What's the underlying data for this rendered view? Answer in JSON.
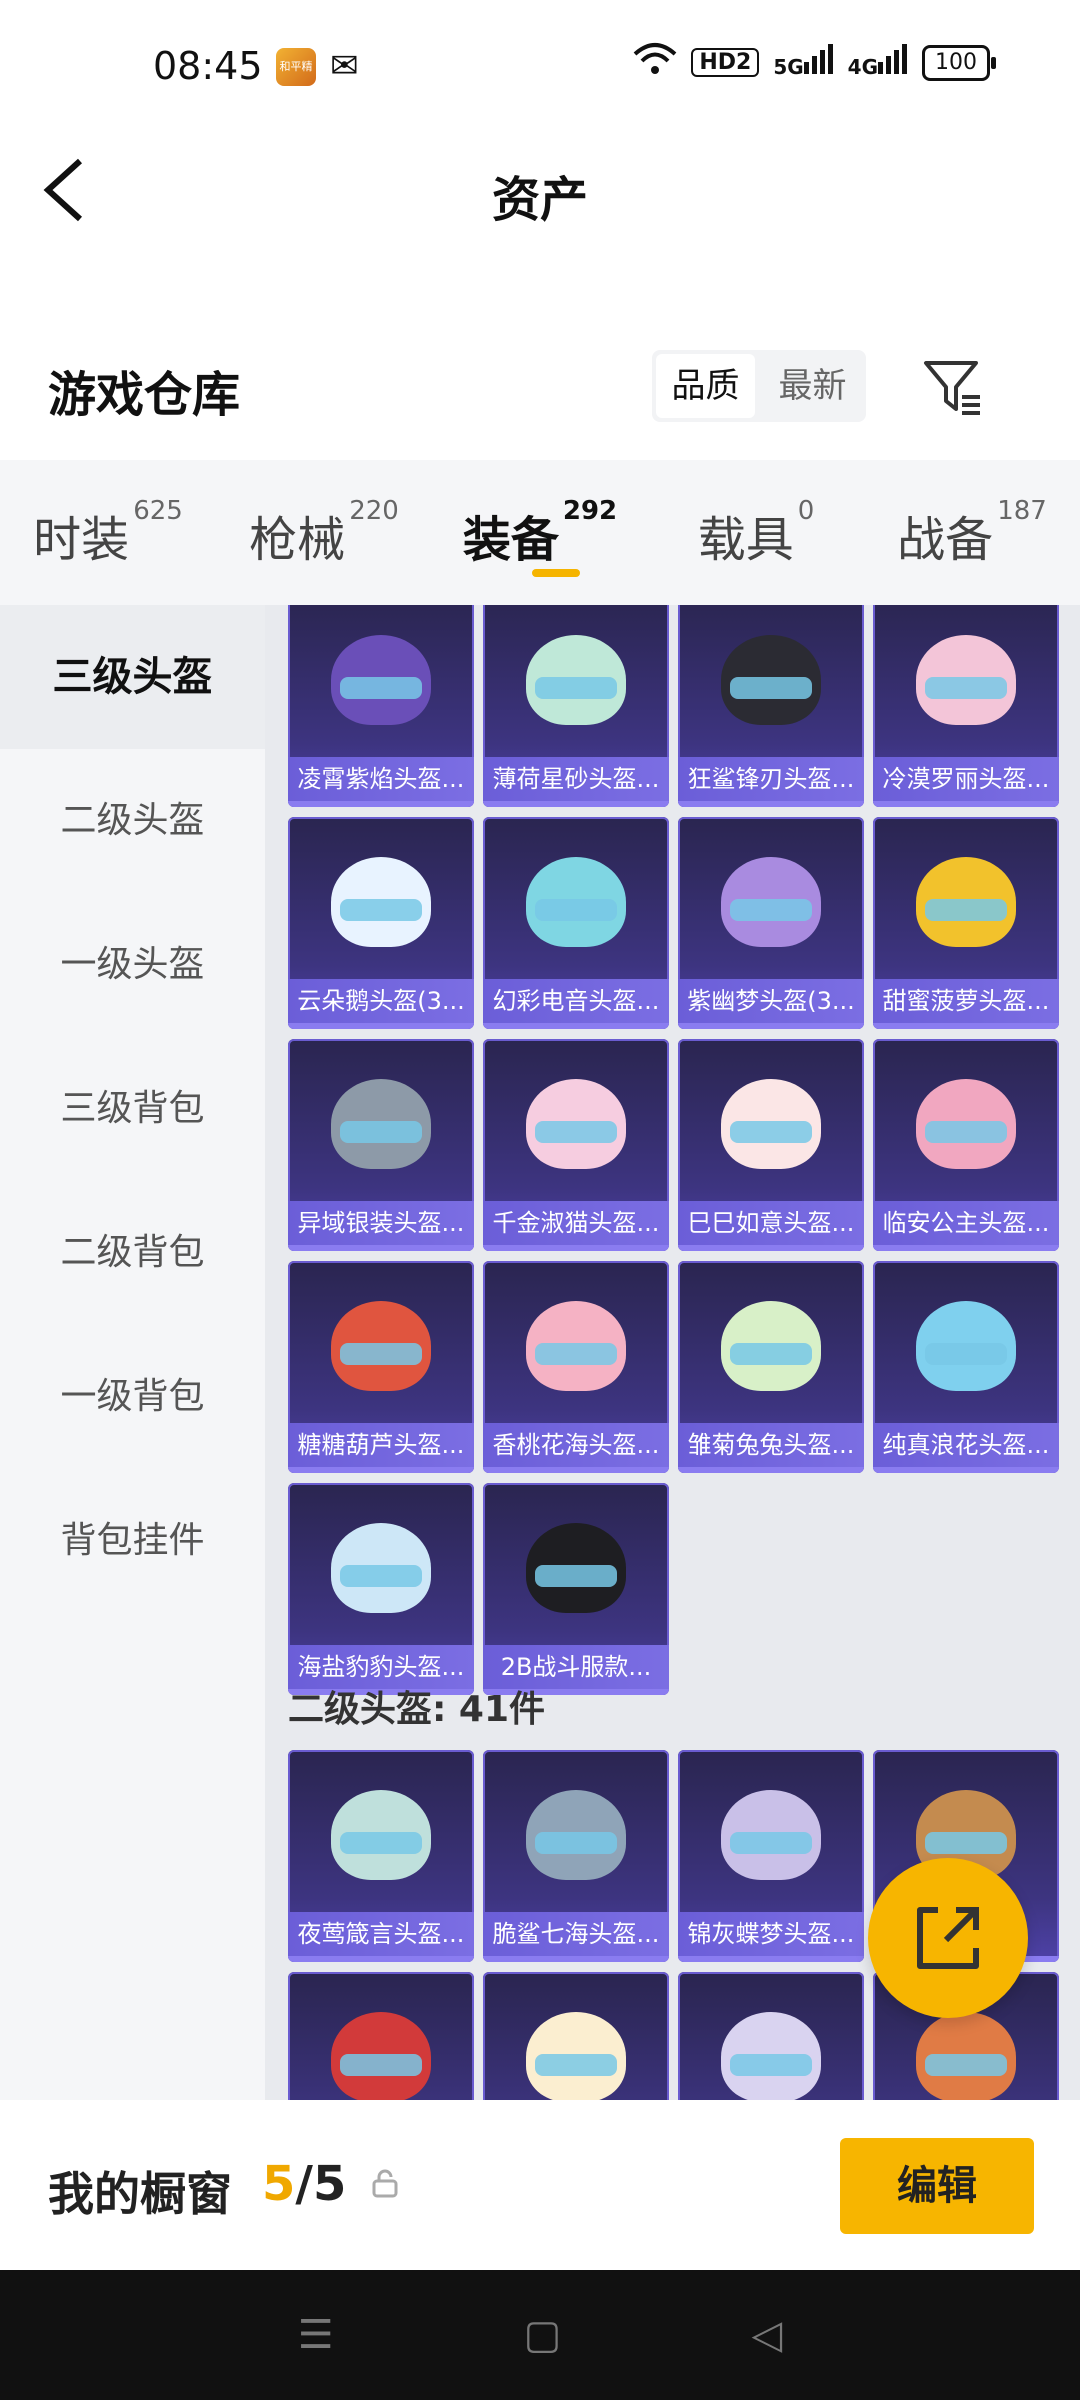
{
  "status": {
    "time": "08:45",
    "app_icon_text": "和平精英",
    "signal1": "5G",
    "signal2": "4G",
    "hd": "HD2",
    "battery": "100"
  },
  "header": {
    "title": "资产",
    "back_icon": "chevron-left-icon"
  },
  "warehouse": {
    "title": "游戏仓库",
    "sort_options": [
      "品质",
      "最新"
    ],
    "sort_selected": "品质",
    "filter_icon": "filter-icon"
  },
  "tabs": [
    {
      "label": "时装",
      "count": "625"
    },
    {
      "label": "枪械",
      "count": "220"
    },
    {
      "label": "装备",
      "count": "292"
    },
    {
      "label": "载具",
      "count": "0"
    },
    {
      "label": "战备",
      "count": "187"
    }
  ],
  "active_tab": "装备",
  "sidebar": [
    "三级头盔",
    "二级头盔",
    "一级头盔",
    "三级背包",
    "二级背包",
    "一级背包",
    "背包挂件"
  ],
  "sidebar_active": "三级头盔",
  "items_lvl3": [
    {
      "name": "凌霄紫焰头盔...",
      "color": "#6a4fb8"
    },
    {
      "name": "薄荷星砂头盔...",
      "color": "#bfe8d8"
    },
    {
      "name": "狂鲨锋刃头盔...",
      "color": "#2b2b33"
    },
    {
      "name": "冷漠罗丽头盔...",
      "color": "#f3c5d8"
    },
    {
      "name": "云朵鹅头盔(3...",
      "color": "#e8f3ff"
    },
    {
      "name": "幻彩电音头盔...",
      "color": "#7fd6e3"
    },
    {
      "name": "紫幽梦头盔(3...",
      "color": "#a98be0"
    },
    {
      "name": "甜蜜菠萝头盔...",
      "color": "#f2c22c"
    },
    {
      "name": "异域银装头盔...",
      "color": "#8d9aa8"
    },
    {
      "name": "千金淑猫头盔...",
      "color": "#f6cde0"
    },
    {
      "name": "巳巳如意头盔...",
      "color": "#fbe6e6"
    },
    {
      "name": "临安公主头盔...",
      "color": "#f1a7c0"
    },
    {
      "name": "糖糖葫芦头盔...",
      "color": "#e0553f"
    },
    {
      "name": "香桃花海头盔...",
      "color": "#f5b2c4"
    },
    {
      "name": "雏菊兔兔头盔...",
      "color": "#d8f0c8"
    },
    {
      "name": "纯真浪花头盔...",
      "color": "#7fd0ee"
    },
    {
      "name": "海盐豹豹头盔...",
      "color": "#cde7f7"
    },
    {
      "name": "2B战斗服款...",
      "color": "#1e1e22"
    }
  ],
  "section_lvl2": "二级头盔: 41件",
  "items_lvl2": [
    {
      "name": "夜莺箴言头盔...",
      "color": "#bfe0dc"
    },
    {
      "name": "脆鲨七海头盔...",
      "color": "#8fa4b8"
    },
    {
      "name": "锦灰蝶梦头盔...",
      "color": "#c9c0e8"
    },
    {
      "name": "",
      "color": "#c48b4f"
    },
    {
      "name": "",
      "color": "#d23a3a"
    },
    {
      "name": "",
      "color": "#fbeed0"
    },
    {
      "name": "",
      "color": "#d9d3f0"
    },
    {
      "name": "",
      "color": "#e07b45"
    }
  ],
  "fab_icon": "share-export-icon",
  "showcase": {
    "label": "我的橱窗",
    "current": "5",
    "total": "5",
    "lock_icon": "lock-icon",
    "edit": "编辑"
  },
  "navbar": {
    "menu_icon": "☰",
    "home_icon": "▢",
    "back_icon": "◁"
  }
}
